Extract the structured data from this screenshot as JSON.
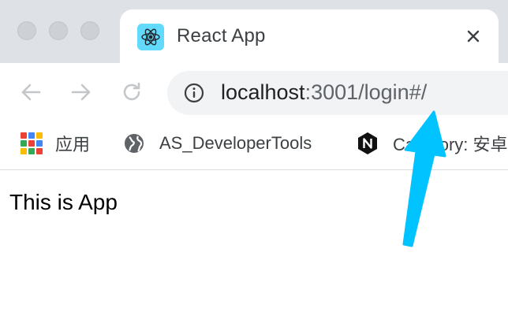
{
  "tab": {
    "title": "React App",
    "favicon": "react-icon",
    "close_icon": "close-icon"
  },
  "toolbar": {
    "back_icon": "back-arrow-icon",
    "forward_icon": "forward-arrow-icon",
    "reload_icon": "reload-icon"
  },
  "address_bar": {
    "info_icon": "info-icon",
    "host": "localhost",
    "path": ":3001/login#/"
  },
  "bookmarks": [
    {
      "label": "应用",
      "icon": "apps-grid-icon"
    },
    {
      "label": "AS_DeveloperTools",
      "icon": "globe-icon"
    },
    {
      "label": "Category: 安卓",
      "icon": "nginx-hexagon-icon"
    }
  ],
  "page": {
    "text": "This is App"
  },
  "annotation": {
    "icon": "pointer-arrow-icon",
    "color": "#00c3ff"
  },
  "colors": {
    "titlebar": "#dee1e6",
    "omnibox": "#f1f3f4",
    "react": "#61dafb"
  }
}
